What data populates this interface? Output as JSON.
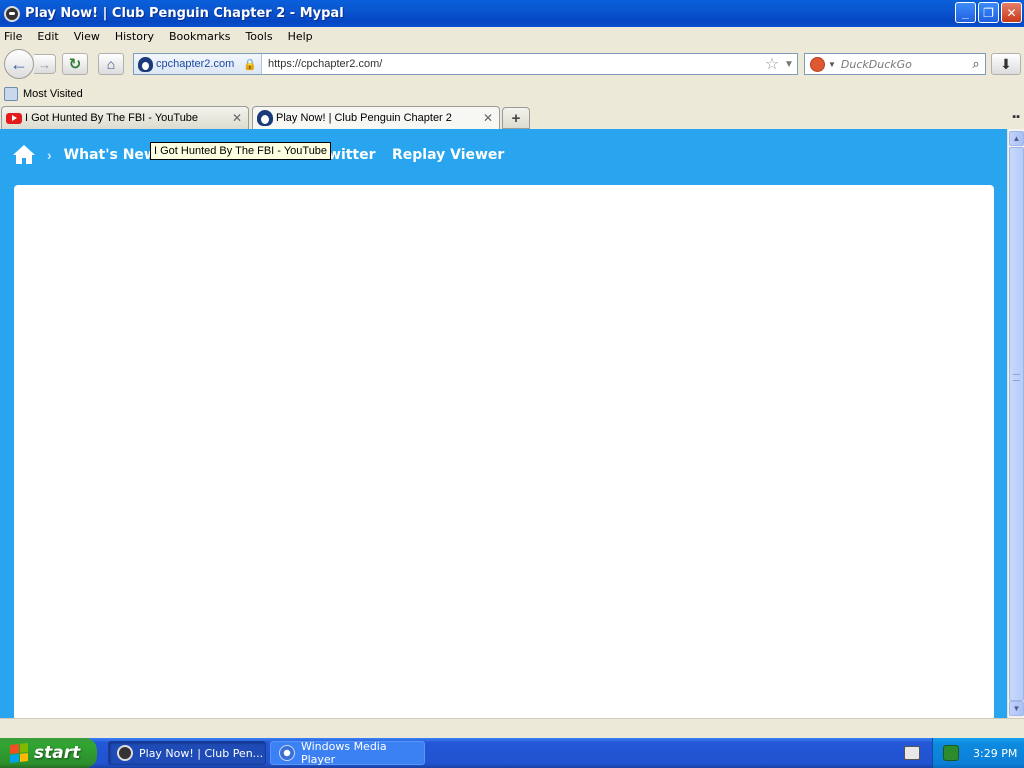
{
  "window": {
    "title": "Play Now! | Club Penguin Chapter 2 - Mypal",
    "buttons": {
      "minimize": "_",
      "maximize": "❐",
      "close": "✕"
    }
  },
  "menu": [
    "File",
    "Edit",
    "View",
    "History",
    "Bookmarks",
    "Tools",
    "Help"
  ],
  "toolbar": {
    "identity_label": "cpchapter2.com",
    "url": "https://cpchapter2.com/",
    "search_placeholder": "DuckDuckGo"
  },
  "bookmarks": {
    "most_visited": "Most Visited"
  },
  "tabs": [
    {
      "label": "I Got Hunted By The FBI - YouTube"
    },
    {
      "label": "Play Now! | Club Penguin Chapter 2"
    }
  ],
  "tooltip": "I Got Hunted By The FBI - YouTube",
  "site_nav": {
    "whats_new": "What's New",
    "twitter": "Twitter",
    "replay_viewer": "Replay Viewer"
  },
  "taskbar": {
    "start": "start",
    "tasks": [
      "Play Now! | Club Pen...",
      "Windows Media Player"
    ],
    "clock": "3:29 PM"
  },
  "colors": {
    "site_blue": "#29A5F0",
    "xp_title_blue": "#0A56D0",
    "start_green": "#31A532"
  }
}
